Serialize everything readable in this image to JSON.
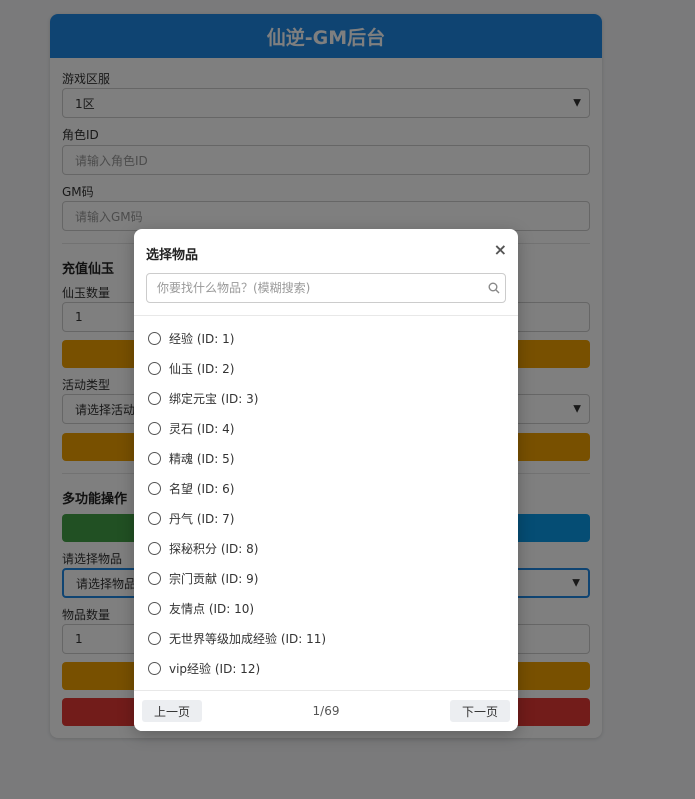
{
  "header": {
    "title": "仙逆-GM后台"
  },
  "form": {
    "server_label": "游戏区服",
    "server_value": "1区",
    "role_label": "角色ID",
    "role_placeholder": "请输入角色ID",
    "gm_label": "GM码",
    "gm_placeholder": "请输入GM码"
  },
  "recharge": {
    "title": "充值仙玉",
    "qty_label": "仙玉数量",
    "qty_value": "1",
    "activity_label": "活动类型",
    "activity_value": "请选择活动"
  },
  "multi": {
    "title": "多功能操作",
    "item_label": "请选择物品",
    "item_value": "请选择物品",
    "qty_label": "物品数量",
    "qty_value": "1"
  },
  "colors": {
    "primary": "#1e88e5",
    "orange": "#f0a000",
    "green": "#43a047",
    "blue": "#0a9ae8",
    "red": "#e53935"
  },
  "modal": {
    "title": "选择物品",
    "close_icon": "×",
    "search_placeholder": "你要找什么物品？(模糊搜索)",
    "items": [
      "经验 (ID: 1)",
      "仙玉 (ID: 2)",
      "绑定元宝 (ID: 3)",
      "灵石 (ID: 4)",
      "精魂 (ID: 5)",
      "名望 (ID: 6)",
      "丹气 (ID: 7)",
      "探秘积分 (ID: 8)",
      "宗门贡献 (ID: 9)",
      "友情点 (ID: 10)",
      "无世界等级加成经验 (ID: 11)",
      "vip经验 (ID: 12)"
    ],
    "prev_label": "上一页",
    "next_label": "下一页",
    "page_info": "1/69"
  }
}
